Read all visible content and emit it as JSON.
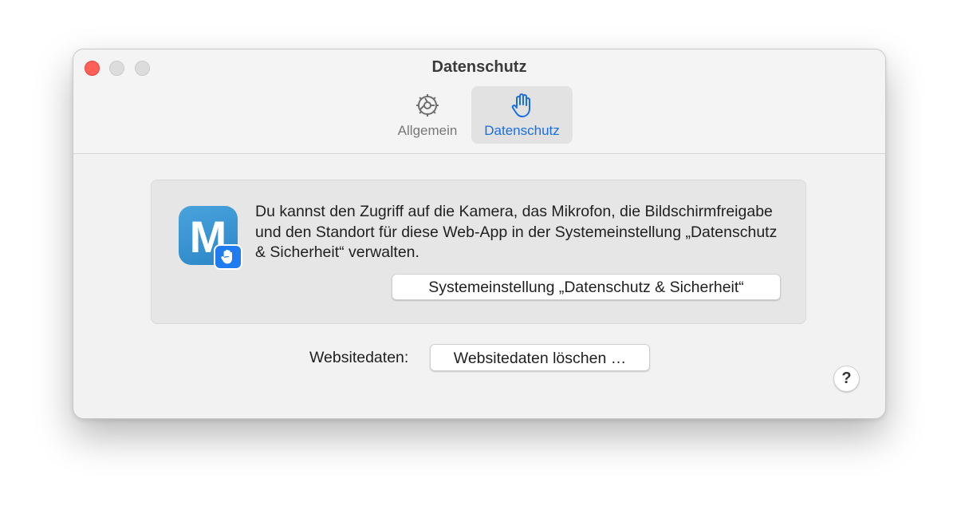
{
  "window": {
    "title": "Datenschutz"
  },
  "tabs": [
    {
      "label": "Allgemein",
      "icon": "gear-icon",
      "selected": false
    },
    {
      "label": "Datenschutz",
      "icon": "hand-icon",
      "selected": true
    }
  ],
  "panel": {
    "app_icon_letter": "M",
    "message": "Du kannst den Zugriff auf die Kamera, das Mikrofon, die Bildschirmfreigabe und den Standort für diese Web-App in der Systemeinstellung „Datenschutz & Sicherheit“ verwalten.",
    "button_label": "Systemeinstellung „Datenschutz & Sicherheit“"
  },
  "website_data": {
    "label": "Websitedaten:",
    "button_label": "Websitedaten löschen …"
  },
  "help": {
    "label": "?"
  },
  "colors": {
    "accent": "#1a6fe0",
    "close_button": "#fe5f57",
    "app_icon": "#2b86c8"
  }
}
